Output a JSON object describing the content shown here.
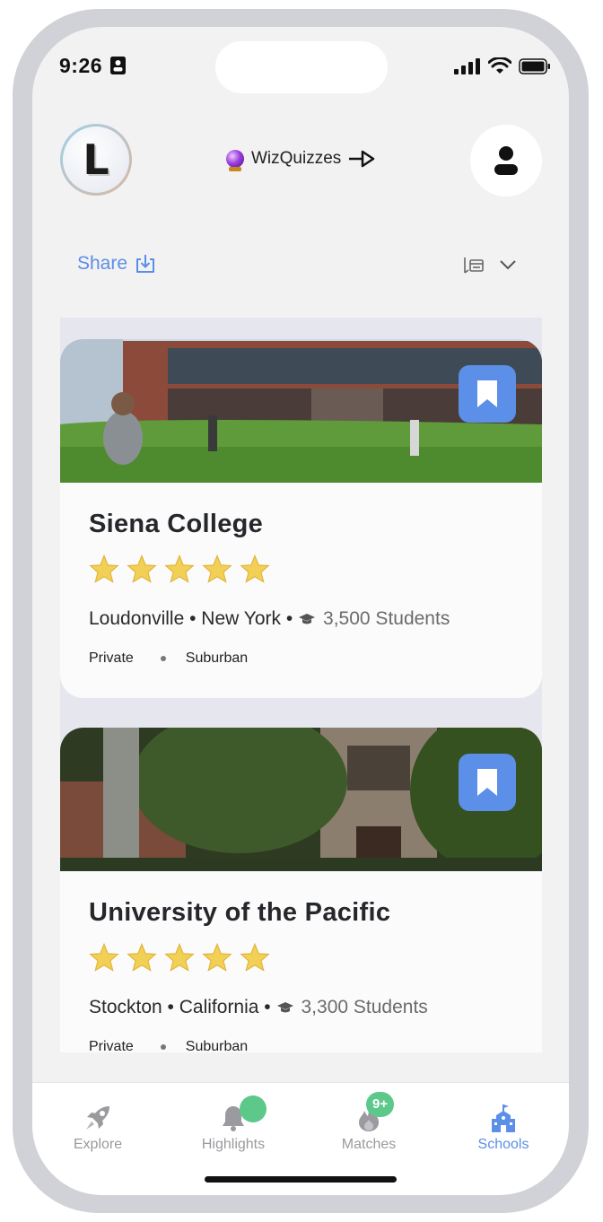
{
  "status_bar": {
    "time": "9:26"
  },
  "header": {
    "logo_letter": "L",
    "quiz_link": "WizQuizzes",
    "quiz_icon": "crystal-ball-icon",
    "profile_icon": "person-icon"
  },
  "toolbar": {
    "share_label": "Share",
    "share_icon": "download-icon",
    "sort_icon": "sort-icon"
  },
  "schools": [
    {
      "name": "Siena College",
      "rating": 5,
      "city": "Loudonville",
      "state": "New York",
      "students": "3,500 Students",
      "type": "Private",
      "setting": "Suburban"
    },
    {
      "name": "University of the Pacific",
      "rating": 5,
      "city": "Stockton",
      "state": "California",
      "students": "3,300 Students",
      "type": "Private",
      "setting": "Suburban"
    }
  ],
  "tabbar": {
    "tabs": [
      {
        "label": "Explore",
        "icon": "rocket-icon"
      },
      {
        "label": "Highlights",
        "icon": "bell-icon"
      },
      {
        "label": "Matches",
        "icon": "flame-icon",
        "badge": "9+"
      },
      {
        "label": "Schools",
        "icon": "school-icon"
      }
    ],
    "active": "Schools"
  },
  "colors": {
    "accent": "#5b8fe8",
    "badge": "#5cc98a",
    "star": "#f2cf55"
  }
}
